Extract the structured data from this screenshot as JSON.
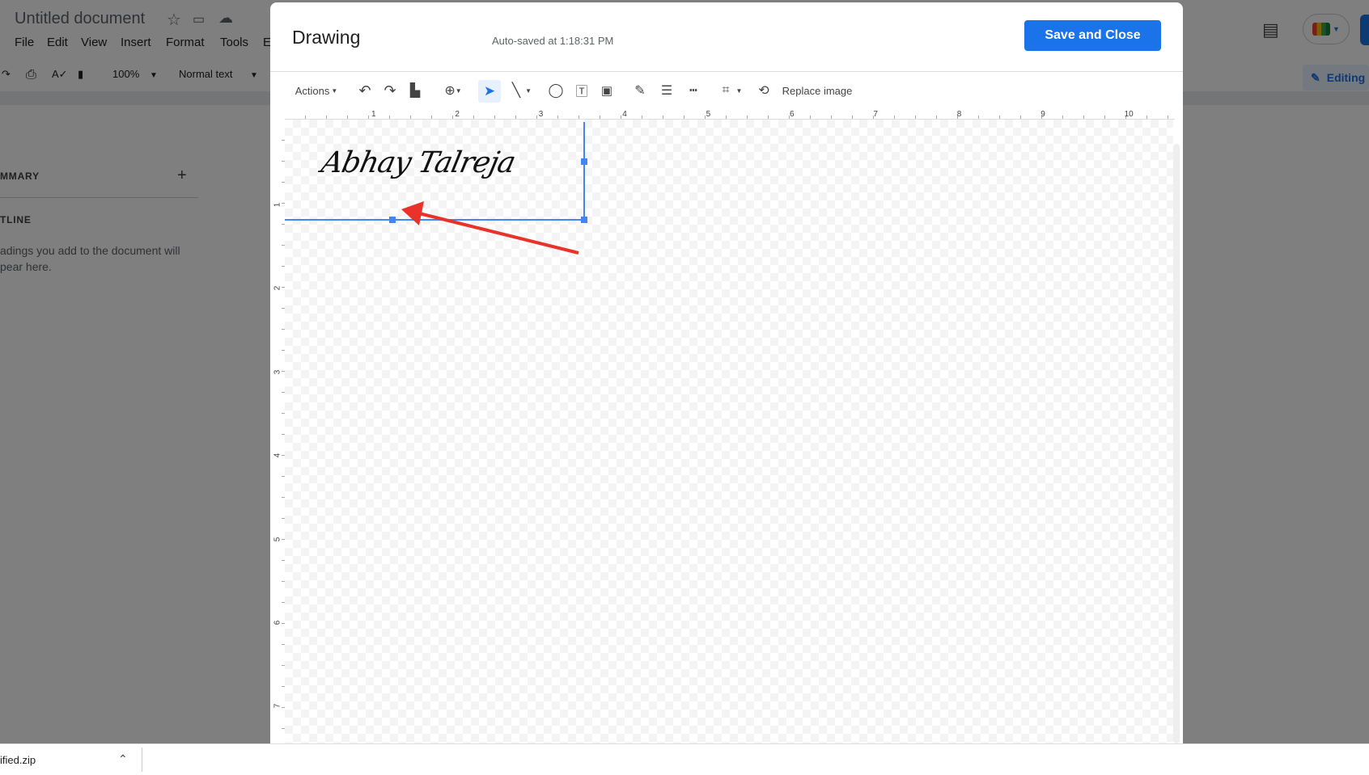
{
  "doc": {
    "title": "Untitled document",
    "menu": [
      "File",
      "Edit",
      "View",
      "Insert",
      "Format",
      "Tools",
      "E"
    ],
    "zoom": "100%",
    "style": "Normal text",
    "editing": "Editing"
  },
  "sidebar": {
    "summary": "MMARY",
    "outline": "TLINE",
    "hint_line1": "adings you add to the document will",
    "hint_line2": "pear here."
  },
  "dialog": {
    "title": "Drawing",
    "autosave": "Auto-saved at 1:18:31 PM",
    "save_label": "Save and Close",
    "actions_label": "Actions",
    "replace_label": "Replace image"
  },
  "ruler": {
    "h": [
      "1",
      "2",
      "3",
      "4",
      "5",
      "6",
      "7",
      "8",
      "9",
      "10"
    ],
    "v": [
      "1",
      "2",
      "3",
      "4",
      "5",
      "6",
      "7"
    ]
  },
  "drawing": {
    "signature": "Abhay Talreja",
    "arrow_color": "#e8322a",
    "selection_color": "#4285f4"
  },
  "download": {
    "file": "ified.zip"
  },
  "colors": {
    "accent": "#1a73e8"
  }
}
